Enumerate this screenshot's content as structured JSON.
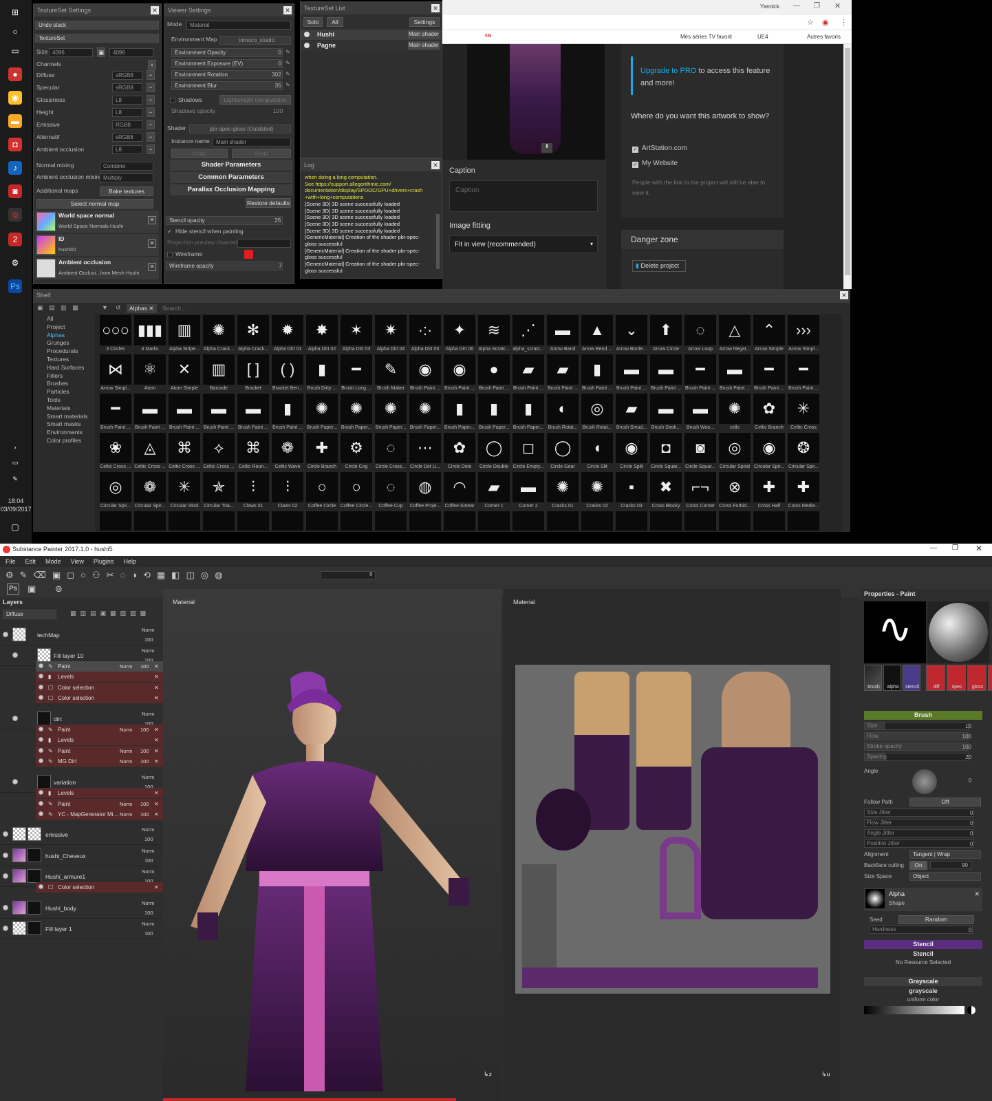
{
  "taskbar": {
    "time": "18:04",
    "date": "03/09/2017"
  },
  "textureset_settings": {
    "title": "TextureSet Settings",
    "undo_stack": "Undo stack",
    "textureset": "TextureSet",
    "size_label": "Size",
    "size_value": "4096",
    "size_value2": "4096",
    "channels_label": "Channels",
    "channels": [
      {
        "name": "Diffuse",
        "format": "sRGB8"
      },
      {
        "name": "Specular",
        "format": "sRGB8"
      },
      {
        "name": "Glossiness",
        "format": "L8"
      },
      {
        "name": "Height",
        "format": "L8"
      },
      {
        "name": "Emissive",
        "format": "RGB8"
      },
      {
        "name": "Alternatif",
        "format": "sRGB8"
      },
      {
        "name": "Ambient occlusion",
        "format": "L8"
      }
    ],
    "normal_mixing_label": "Normal mixing",
    "normal_mixing_value": "Combine",
    "ao_mixing_label": "Ambient occlusion mixing",
    "ao_mixing_value": "Multiply",
    "additional_maps": "Additional maps",
    "bake_textures": "Bake textures",
    "select_normal_map": "Select normal map",
    "maps": [
      {
        "title": "World space normal",
        "sub": "World Space Normals Hushi"
      },
      {
        "title": "ID",
        "sub": "hushiID"
      },
      {
        "title": "Ambient occlusion",
        "sub": "Ambient Occlusi...from Mesh Hushi"
      }
    ]
  },
  "viewer_settings": {
    "title": "Viewer Settings",
    "mode_label": "Mode",
    "mode_value": "Material",
    "env_map_label": "Environment Map",
    "env_map_value": "tomoco_studio",
    "sliders": [
      {
        "label": "Environment Opacity",
        "value": "0"
      },
      {
        "label": "Environment Exposure (EV)",
        "value": "0"
      },
      {
        "label": "Environment Rotation",
        "value": "302"
      },
      {
        "label": "Environment Blur",
        "value": "35"
      }
    ],
    "shadows": "Shadows",
    "lightweight": "Lightweight computation",
    "shadows_opacity": "Shadows opacity",
    "shadows_opacity_value": "100",
    "shader_label": "Shader",
    "shader_value": "pbr-spec-gloss (Outdated)",
    "instance_label": "Instance name",
    "instance_value": "Main shader",
    "undo": "Undo",
    "redo": "Redo",
    "sections": [
      "Shader Parameters",
      "Common Parameters",
      "Parallax Occlusion Mapping"
    ],
    "restore_defaults": "Restore defaults",
    "stencil_opacity": "Stencil opacity",
    "stencil_opacity_value": "25",
    "hide_stencil": "Hide stencil when painting",
    "projection_channel": "Projection preview channel",
    "wireframe": "Wireframe",
    "wireframe_opacity": "Wireframe opacity",
    "wireframe_opacity_value": "7"
  },
  "textureset_list": {
    "title": "TextureSet List",
    "solo": "Solo",
    "all": "All",
    "settings": "Settings",
    "items": [
      {
        "name": "Hushi",
        "shader": "Main shader"
      },
      {
        "name": "Pagne",
        "shader": "Main shader"
      }
    ]
  },
  "log": {
    "title": "Log",
    "lines": [
      "when doing a long computation.",
      "   See https://support.allegorithmic.com/",
      "documentation/display/SPDOC/GPU+drivers+crash",
      "+with+long+computations",
      "[Scene 3D] 3D scene successfully loaded",
      "[Scene 3D] 3D scene successfully loaded",
      "[Scene 3D] 3D scene successfully loaded",
      "[Scene 3D] 3D scene successfully loaded",
      "[Scene 3D] 3D scene successfully loaded",
      "[GenericMaterial] Creation of the shader pbr-spec-",
      "gloss successful",
      "[GenericMaterial] Creation of the shader pbr-spec-",
      "gloss successful",
      "[GenericMaterial] Creation of the shader pbr-spec-",
      "gloss successful"
    ]
  },
  "browser": {
    "user": "Yannick",
    "bookmarks": [
      "KB",
      "Mes séries TV favorit",
      "UE4",
      "Autres favoris"
    ],
    "upgrade_link": "Upgrade to PRO",
    "upgrade_text": " to access this feature and more!",
    "where_heading": "Where do you want this artwork to show?",
    "options": [
      "ArtStation.com",
      "My Website"
    ],
    "note": "People with the link to the project will still be able to view it.",
    "caption_label": "Caption",
    "caption_placeholder": "Caption",
    "image_fitting_label": "Image fitting",
    "image_fitting_value": "Fit in view (recommended)",
    "danger_zone": "Danger zone",
    "delete_project": "Delete project"
  },
  "shelf": {
    "title": "Shelf",
    "filter_tag": "Alphas",
    "search_placeholder": "Search...",
    "categories": [
      "All",
      "Project",
      "Alphas",
      "Grunges",
      "Procedurals",
      "Textures",
      "Hard Surfaces",
      "Filters",
      "Brushes",
      "Particles",
      "Tools",
      "Materials",
      "Smart materials",
      "Smart masks",
      "Environments",
      "Color profiles"
    ],
    "selected_category": "Alphas",
    "rows": [
      [
        "3 Circles",
        "4 Marks",
        "Alpha Stripe...",
        "Alpha Crack...",
        "Alpha Crack...",
        "Alpha Dirt 01",
        "Alpha Dirt 02",
        "Alpha Dirt 03",
        "Alpha Dirt 04",
        "Alpha Dirt 05",
        "Alpha Dirt 06",
        "Alpha Scratc...",
        "alpha_scratc...",
        "Arrow Band",
        "Arrow Bend ...",
        "Arrow Borde...",
        "Arrow Circle",
        "Arrow Loop",
        "Arrow Negat...",
        "Arrow Simple",
        "Arrow Simpl..."
      ],
      [
        "Arrow Simpl...",
        "Atom",
        "Atom Simple",
        "Barcode",
        "Bracket",
        "Bracket Ben...",
        "Brush Dirty ...",
        "Brush Long ...",
        "Brush Maker",
        "Brush Paint ...",
        "Brush Paint ...",
        "Brush Paint ...",
        "Brush Paint ...",
        "Brush Paint ...",
        "Brush Paint ...",
        "Brush Paint ...",
        "Brush Paint ...",
        "Brush Paint ...",
        "Brush Paint ...",
        "Brush Paint ...",
        "Brush Paint ..."
      ],
      [
        "Brush Paint ...",
        "Brush Paint ...",
        "Brush Paint ...",
        "Brush Paint ...",
        "Brush Paint ...",
        "Brush Paint ...",
        "Brush Paper...",
        "Brush Paper...",
        "Brush Paper...",
        "Brush Paper...",
        "Brush Paper...",
        "Brush Paper...",
        "Brush Paper...",
        "Brush Rotat...",
        "Brush Rotat...",
        "Brush Smud...",
        "Brush Strok...",
        "Brush Woo...",
        "cells",
        "Celtic Branch",
        "Celtic Cross"
      ],
      [
        "Celtic Cross ...",
        "Celtic Cross ...",
        "Celtic Cross ...",
        "Celtic Cross ...",
        "Celtic Roun...",
        "Celtic Wave",
        "Circle Branch",
        "Circle Cog",
        "Circle Cross...",
        "Circle Dot Li...",
        "Circle Dots",
        "Circle Double",
        "Circle Empty...",
        "Circle Gear",
        "Circle Slit",
        "Circle Split",
        "Circle Squar...",
        "Circle Squar...",
        "Circular Spiral",
        "Circular Spir...",
        "Circular Spir..."
      ],
      [
        "Circular Spir...",
        "Circular Spir...",
        "Circular Stick",
        "Circular Tria...",
        "Claws 01",
        "Claws 02",
        "Coffee Circle",
        "Coffee Circle...",
        "Coffee Cup",
        "Coffee Proje...",
        "Coffee Smear",
        "Corner 1",
        "Corner 2",
        "Cracks 01",
        "Cracks 02",
        "Cracks 03",
        "Cross Blocky",
        "Cross Corner",
        "Cross Forbid...",
        "Cross Half",
        "Cross Medie..."
      ]
    ],
    "glyphs": [
      [
        "○○○",
        "▮▮▮",
        "▥",
        "✺",
        "✻",
        "✹",
        "✸",
        "✶",
        "✷",
        "·:·",
        "✦",
        "≋",
        "⋰",
        "▬",
        "▲",
        "⌄",
        "⬆",
        "◌",
        "△",
        "⌃",
        "›››"
      ],
      [
        "⋈",
        "⚛",
        "✕",
        "▥",
        "[ ]",
        "( )",
        "▮",
        "━",
        "✎",
        "◉",
        "◉",
        "●",
        "▰",
        "▰",
        "▮",
        "▬",
        "▬",
        "━",
        "▬",
        "━",
        "━"
      ],
      [
        "━",
        "▬",
        "▬",
        "▬",
        "▬",
        "▮",
        "✺",
        "✺",
        "✺",
        "✺",
        "▮",
        "▮",
        "▮",
        "◐",
        "◎",
        "▰",
        "▬",
        "▬",
        "✺",
        "✿",
        "✳"
      ],
      [
        "❀",
        "◬",
        "⌘",
        "⟡",
        "⌘",
        "❁",
        "✚",
        "⚙",
        "◌",
        "⋯",
        "✿",
        "◯",
        "◻",
        "◯",
        "◖",
        "◉",
        "◘",
        "◙",
        "◎",
        "◉",
        "❂"
      ],
      [
        "◎",
        "❁",
        "✳",
        "✯",
        "⫶",
        "⫶",
        "○",
        "○",
        "◌",
        "◍",
        "◠",
        "▰",
        "▬",
        "✺",
        "✺",
        "▪",
        "✖",
        "⌐¬",
        "⊗",
        "✚",
        "✚"
      ]
    ]
  },
  "sp": {
    "title": "Substance Painter 2017.1.0 - hushi5",
    "menu": [
      "File",
      "Edit",
      "Mode",
      "View",
      "Plugins",
      "Help"
    ],
    "toolbar_value": "8",
    "layers_title": "Layers",
    "channel": "Diffuse",
    "viewport_left": "Material",
    "viewport_right": "Material",
    "layers": [
      {
        "name": "techMap",
        "blend": "Norm",
        "op": "100",
        "kind": "fill"
      },
      {
        "name": "Fill layer 10",
        "blend": "Norm",
        "op": "100",
        "kind": "fill"
      },
      {
        "name": "dirt",
        "blend": "Norm",
        "op": "100",
        "kind": "dark"
      },
      {
        "name": "variation",
        "blend": "Norm",
        "op": "100",
        "kind": "dark"
      },
      {
        "name": "emissive",
        "blend": "Norm",
        "op": "100",
        "kind": "fill"
      },
      {
        "name": "hushi_Cheveux",
        "blend": "Norm",
        "op": "100",
        "kind": "purple"
      },
      {
        "name": "Hushi_armure1",
        "blend": "Norm",
        "op": "100",
        "kind": "purple"
      },
      {
        "name": "Hushi_body",
        "blend": "Norm",
        "op": "100",
        "kind": "purple"
      },
      {
        "name": "Fill layer 1",
        "blend": "Norm",
        "op": "100",
        "kind": "fill"
      }
    ],
    "effects": [
      [
        {
          "name": "Paint",
          "blend": "Norm",
          "op": "100",
          "sel": true
        },
        {
          "name": "Levels"
        },
        {
          "name": "Color selection"
        },
        {
          "name": "Color selection"
        }
      ],
      [
        {
          "name": "Paint",
          "blend": "Norm",
          "op": "100"
        },
        {
          "name": "Levels"
        },
        {
          "name": "Paint",
          "blend": "Norm",
          "op": "100"
        },
        {
          "name": "MG Dirt",
          "blend": "Norm",
          "op": "100"
        }
      ],
      [
        {
          "name": "Levels"
        },
        {
          "name": "Paint",
          "blend": "Norm",
          "op": "100"
        },
        {
          "name": "YC - MapGenerator Mi...",
          "blend": "Norm",
          "op": "100"
        }
      ],
      [
        {
          "name": "Color selection"
        }
      ]
    ],
    "properties_title": "Properties - Paint",
    "mat_tabs": [
      "brush",
      "alpha",
      "stencil"
    ],
    "mat_tabs2": [
      "diff",
      "spec",
      "gloss",
      "he"
    ],
    "brush_section": "Brush",
    "brush_rows": [
      {
        "label": "Size",
        "value": "10"
      },
      {
        "label": "Flow",
        "value": "100"
      },
      {
        "label": "Stroke opacity",
        "value": "100"
      },
      {
        "label": "Spacing",
        "value": "20"
      }
    ],
    "angle_label": "Angle",
    "angle_value": "0",
    "follow_path": "Follow Path",
    "follow_path_value": "Off",
    "jitter_rows": [
      {
        "label": "Size Jitter",
        "value": "0"
      },
      {
        "label": "Flow Jitter",
        "value": "0"
      },
      {
        "label": "Angle Jitter",
        "value": "0"
      },
      {
        "label": "Position Jitter",
        "value": "0"
      }
    ],
    "alignment_label": "Alignment",
    "alignment_value": "Tangent | Wrap",
    "backface_label": "Backface culling",
    "backface_on": "On",
    "backface_value": "90",
    "size_space_label": "Size Space",
    "size_space_value": "Object",
    "alpha_title": "Alpha",
    "alpha_sub": "Shape",
    "seed_label": "Seed",
    "seed_value": "Random",
    "hardness_label": "Hardness",
    "hardness_value": "0",
    "stencil_section": "Stencil",
    "stencil_title": "Stencil",
    "stencil_sub": "No Resource Selected",
    "grayscale_section": "Grayscale",
    "grayscale_title": "grayscale",
    "grayscale_sub": "uniform color"
  },
  "colors": {
    "accent_green": "#6b8e23",
    "accent_purple": "#5a2d82",
    "layer_effect": "#5a2a2a",
    "link_blue": "#1e88e5"
  }
}
